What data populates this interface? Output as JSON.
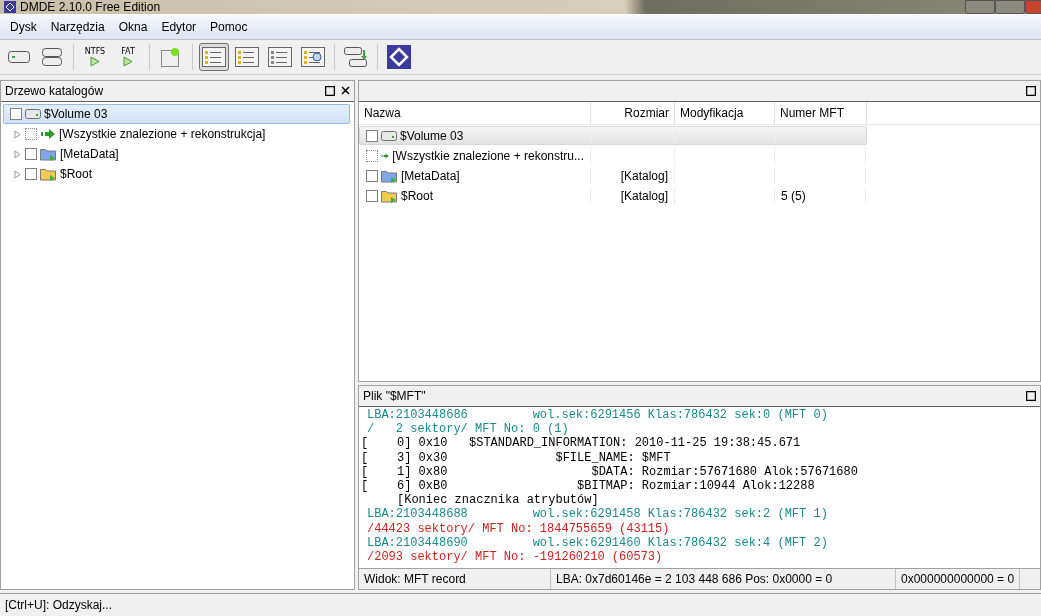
{
  "window": {
    "title": "DMDE 2.10.0 Free Edition"
  },
  "menu": [
    "Dysk",
    "Narzędzia",
    "Okna",
    "Edytor",
    "Pomoc"
  ],
  "toolbar": [
    {
      "kind": "drive",
      "selected": false
    },
    {
      "kind": "disks",
      "selected": false
    },
    {
      "kind": "sep"
    },
    {
      "kind": "fs",
      "label": "NTFS",
      "selected": false
    },
    {
      "kind": "fs",
      "label": "FAT",
      "selected": false
    },
    {
      "kind": "sep"
    },
    {
      "kind": "new",
      "selected": false
    },
    {
      "kind": "sep"
    },
    {
      "kind": "tree",
      "selected": true
    },
    {
      "kind": "list",
      "selected": false
    },
    {
      "kind": "details",
      "selected": false
    },
    {
      "kind": "find",
      "selected": false
    },
    {
      "kind": "sep"
    },
    {
      "kind": "recover",
      "selected": false
    },
    {
      "kind": "sep"
    },
    {
      "kind": "logo",
      "selected": false
    }
  ],
  "tree_panel": {
    "title": "Drzewo katalogów",
    "items": [
      {
        "label": "$Volume 03",
        "kind": "volume",
        "selected": true,
        "children": [
          {
            "label": "[Wszystkie znalezione + rekonstrukcja]",
            "kind": "found",
            "selected": false
          },
          {
            "label": "[MetaData]",
            "kind": "metadata",
            "selected": false
          },
          {
            "label": "$Root",
            "kind": "folder",
            "selected": false
          }
        ]
      }
    ]
  },
  "file_panel": {
    "columns": [
      "Nazwa",
      "Rozmiar",
      "Modyfikacja",
      "Numer MFT"
    ],
    "rows": [
      {
        "name": "$Volume 03",
        "kind": "volume",
        "selected": true
      },
      {
        "name": "[Wszystkie znalezione + rekonstru...",
        "kind": "found",
        "selected": false
      },
      {
        "name": "[MetaData]",
        "kind": "metadata",
        "size": "[Katalog]",
        "selected": false
      },
      {
        "name": "$Root",
        "kind": "folder",
        "size": "[Katalog]",
        "mft": "5 (5)",
        "selected": false
      }
    ]
  },
  "record_panel": {
    "title": "Plik \"$MFT\"",
    "lines": [
      {
        "kind": "info",
        "text": "LBA:2103448686         wol.sek:6291456 Klas:786432 sek:0 (MFT 0)"
      },
      {
        "kind": "info",
        "text": "/   2 sektory/ MFT No: 0 (1)"
      },
      {
        "kind": "attr",
        "text": "[    0] 0x10   $STANDARD_INFORMATION: 2010-11-25 19:38:45.671"
      },
      {
        "kind": "attr",
        "text": "[    3] 0x30               $FILE_NAME: $MFT"
      },
      {
        "kind": "attr",
        "text": "[    1] 0x80                    $DATA: Rozmiar:57671680 Alok:57671680"
      },
      {
        "kind": "attr",
        "text": "[    6] 0xB0                  $BITMAP: Rozmiar:10944 Alok:12288"
      },
      {
        "kind": "attr",
        "text": "     [Koniec znacznika atrybutów]"
      },
      {
        "kind": "info",
        "text": "LBA:2103448688         wol.sek:6291458 Klas:786432 sek:2 (MFT 1)"
      },
      {
        "kind": "error",
        "text": "/44423 sektory/ MFT No: 1844755659 (43115)"
      },
      {
        "kind": "info",
        "text": "LBA:2103448690         wol.sek:6291460 Klas:786432 sek:4 (MFT 2)"
      },
      {
        "kind": "error",
        "text": "/2093 sektory/ MFT No: -191260210 (60573)"
      }
    ],
    "status": [
      "Widok: MFT record",
      "LBA: 0x7d60146e = 2 103 448 686  Pos: 0x0000 = 0",
      "0x000000000000 = 0"
    ]
  },
  "status_bar": "[Ctrl+U]: Odzyskaj..."
}
